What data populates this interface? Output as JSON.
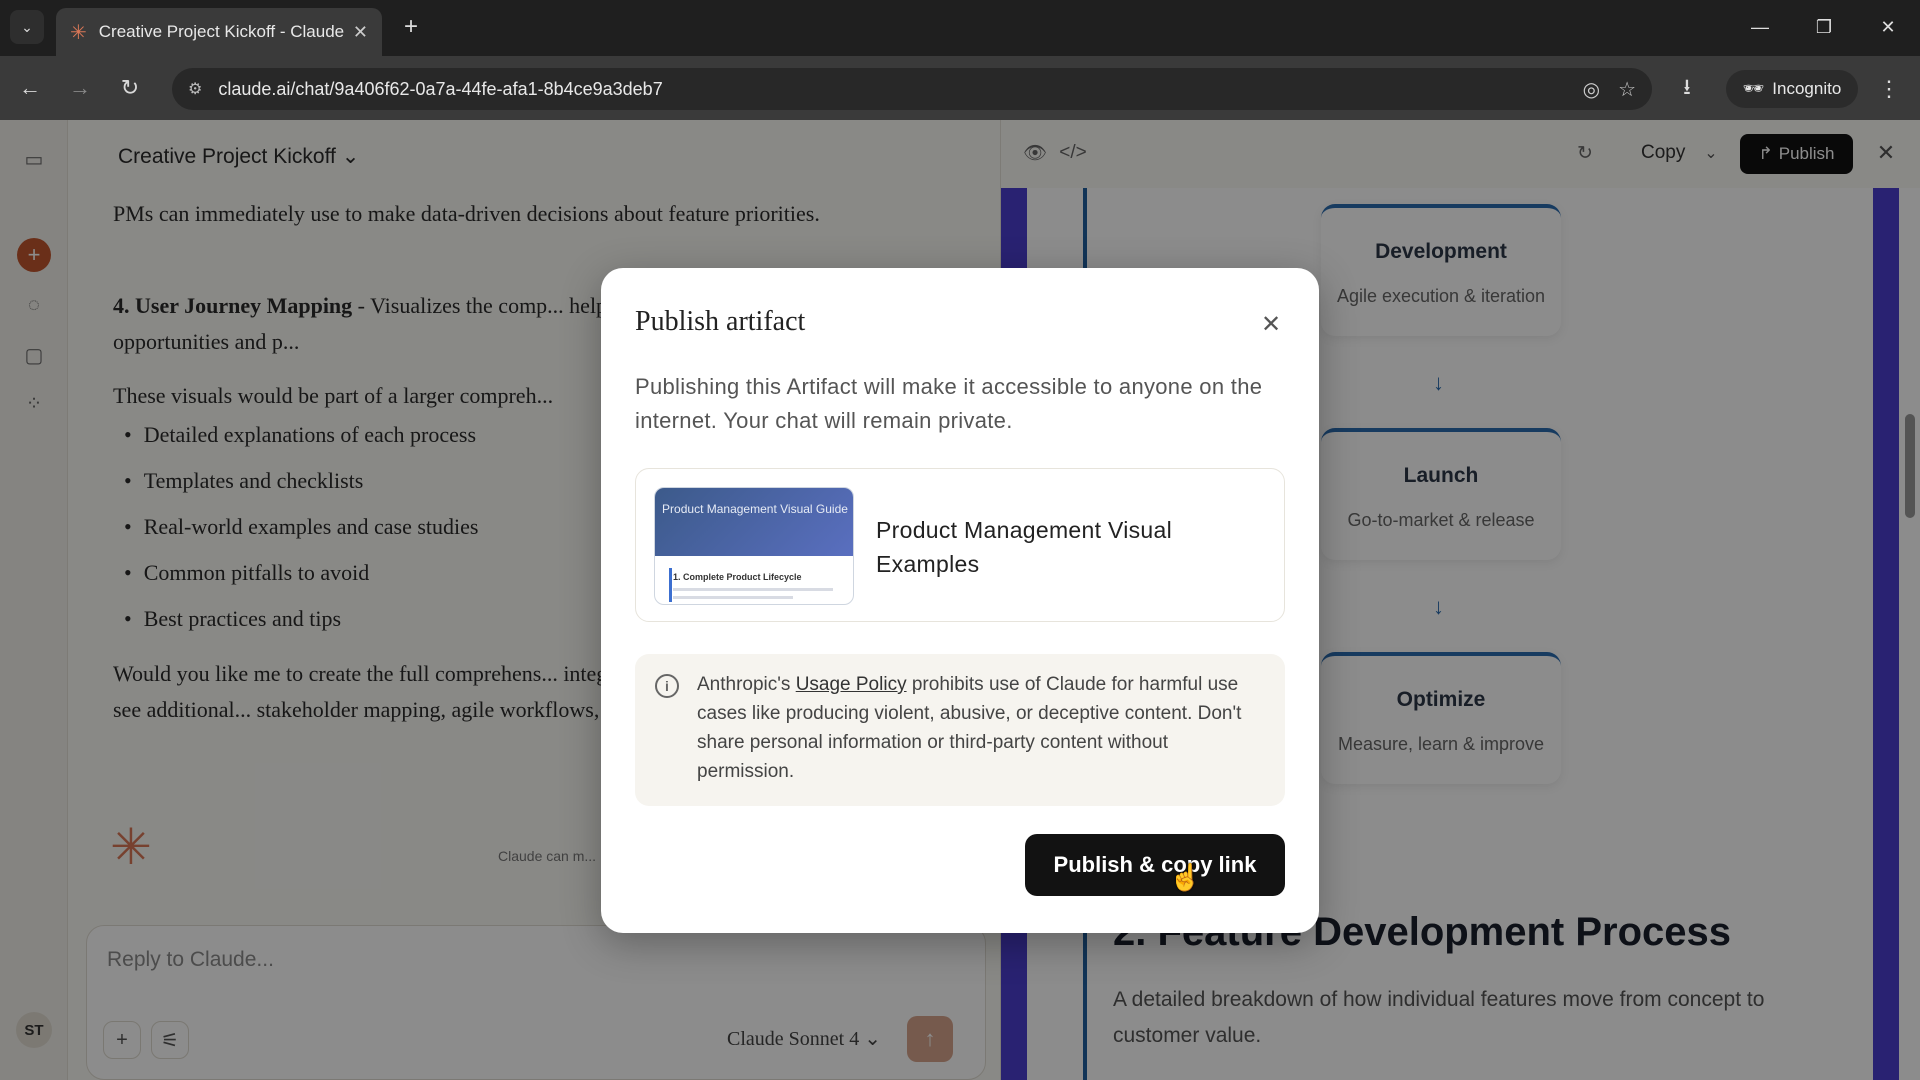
{
  "browser": {
    "tab_title": "Creative Project Kickoff - Claude",
    "url": "claude.ai/chat/9a406f62-0a7a-44fe-afa1-8b4ce9a3deb7",
    "incognito_label": "Incognito"
  },
  "chat": {
    "title": "Creative Project Kickoff",
    "para1": "PMs can immediately use to make data-driven decisions about feature priorities.",
    "para2_bold": "4. User Journey Mapping",
    "para2_rest": " - Visualizes the comp... help identify improvement opportunities and p...",
    "para3": "These visuals would be part of a larger compreh...",
    "bullets": [
      "Detailed explanations of each process",
      "Templates and checklists",
      "Real-world examples and case studies",
      "Common pitfalls to avoid",
      "Best practices and tips"
    ],
    "para4": "Would you like me to create the full comprehens... integrated, or would you prefer to see additional... stakeholder mapping, agile workflows, or metric...",
    "disclaimer": "Claude can m...",
    "reply_placeholder": "Reply to Claude...",
    "model_name": "Claude Sonnet 4",
    "avatar_initials": "ST"
  },
  "artifact": {
    "copy_label": "Copy",
    "publish_label": "Publish",
    "stages": [
      {
        "name": "Development",
        "desc": "Agile execution & iteration"
      },
      {
        "name": "Launch",
        "desc": "Go-to-market & release"
      },
      {
        "name": "Optimize",
        "desc": "Measure, learn & improve"
      }
    ],
    "section_title": "2. Feature Development Process",
    "section_desc": "A detailed breakdown of how individual features move from concept to customer value."
  },
  "modal": {
    "title": "Publish artifact",
    "description": "Publishing this Artifact will make it accessible to anyone on the internet. Your chat will remain private.",
    "artifact_name": "Product Management Visual Examples",
    "thumb_title": "Product Management Visual Guide",
    "thumb_subtitle": "1. Complete Product Lifecycle",
    "notice_prefix": "Anthropic's ",
    "notice_link": "Usage Policy",
    "notice_suffix": " prohibits use of Claude for harmful use cases like producing violent, abusive, or deceptive content. Don't share personal information or third-party content without permission.",
    "publish_button": "Publish & copy link"
  }
}
